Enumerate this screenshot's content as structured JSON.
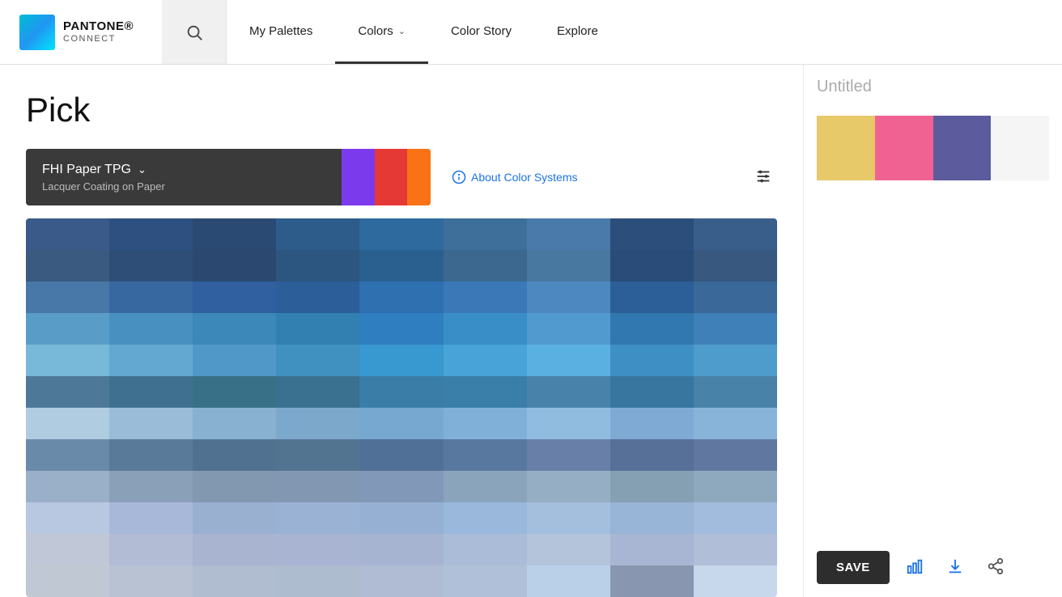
{
  "navbar": {
    "logo_brand": "PANTONE®",
    "logo_sub": "CONNECT",
    "nav_items": [
      {
        "id": "search",
        "label": "",
        "icon": "search-icon",
        "type": "search"
      },
      {
        "id": "my-palettes",
        "label": "My Palettes",
        "active": false
      },
      {
        "id": "colors",
        "label": "Colors",
        "active": true,
        "has_chevron": true
      },
      {
        "id": "color-story",
        "label": "Color Story",
        "active": false
      },
      {
        "id": "explore",
        "label": "Explore",
        "active": false
      }
    ]
  },
  "page": {
    "title": "Pick",
    "color_system": {
      "name": "FHI Paper TPG",
      "subtitle": "Lacquer Coating on Paper"
    },
    "about_label": "About Color Systems",
    "palette_title": "Untitled",
    "save_label": "SAVE"
  },
  "swatches": [
    {
      "color": "#e8c96a"
    },
    {
      "color": "#f06292"
    },
    {
      "color": "#5c5b9e"
    }
  ],
  "color_grid": {
    "colors": [
      "#3a5a8a",
      "#2e5080",
      "#2a4a73",
      "#2d5c8a",
      "#2e6a9e",
      "#3e6e9a",
      "#4a7aaa",
      "#2c4e7a",
      "#3a5e8a",
      "#3a5a80",
      "#2e4e78",
      "#2a4870",
      "#2c5680",
      "#2a6090",
      "#3c6890",
      "#4878a0",
      "#2a4c78",
      "#385880",
      "#4878a8",
      "#3868a0",
      "#3060a0",
      "#2c5e9a",
      "#2e70b0",
      "#3a78b8",
      "#4e88c0",
      "#2c5e98",
      "#3a6898",
      "#5a9cc8",
      "#4890c0",
      "#3c88b8",
      "#3280b2",
      "#2e7ec0",
      "#3a8ec8",
      "#509ad0",
      "#3278b0",
      "#4080b8",
      "#78b8d8",
      "#62a8d0",
      "#5098c8",
      "#4090c0",
      "#3898d0",
      "#48a4d8",
      "#5ab0e0",
      "#3e90c4",
      "#4e9ccc",
      "#4e7898",
      "#407090",
      "#387088",
      "#3a7090",
      "#3a7ea8",
      "#3a7eaa",
      "#4882aa",
      "#3876a0",
      "#4882a8",
      "#b0cce0",
      "#9abcd8",
      "#88b0d0",
      "#7ca8cc",
      "#76a8d0",
      "#80b0d8",
      "#90bce0",
      "#7eaad4",
      "#88b4da",
      "#6a8aaa",
      "#5a7a9a",
      "#507290",
      "#527490",
      "#507098",
      "#5878a0",
      "#6880a8",
      "#567098",
      "#6078a0",
      "#9ab0c8",
      "#8aa0b8",
      "#8298b0",
      "#8298b2",
      "#8298b8",
      "#8aa4bc",
      "#96aec4",
      "#84a0b2",
      "#8ea8be",
      "#b8c8e0",
      "#a8b8d8",
      "#9ab0d0",
      "#9ab2d4",
      "#96b0d4",
      "#9ab8dc",
      "#a4bede",
      "#98b4d6",
      "#a2bcde",
      "#c0c8d8",
      "#b2bcd4",
      "#a8b4d0",
      "#a8b4d2",
      "#a6b4d2",
      "#aabcd8",
      "#b4c4da",
      "#a8b6d4",
      "#b0bed8",
      "#c0c8d4",
      "#b8c2d2",
      "#b0bcd0",
      "#aebcd0",
      "#b0bcd4",
      "#b0c0d8",
      "#bad0e8",
      "#8896b0",
      "#c8d8ec"
    ],
    "cols": 9,
    "rows": 12
  }
}
